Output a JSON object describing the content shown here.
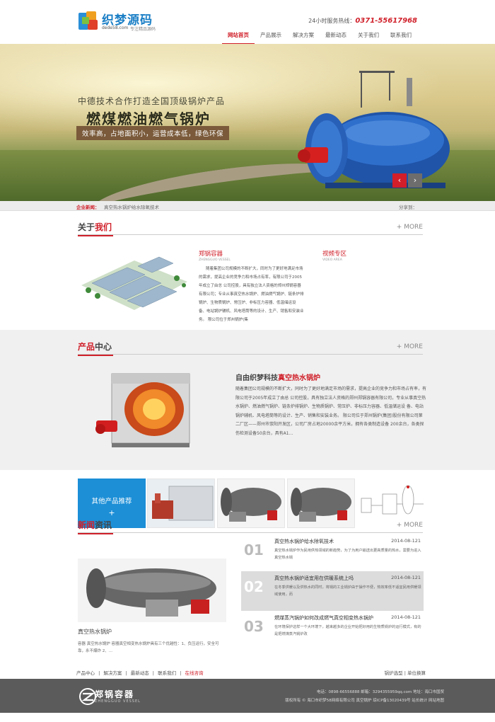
{
  "header": {
    "logo_text": "织梦源码",
    "logo_domain": "dede58.com",
    "logo_slogan": "专注精品源码",
    "hotline_label": "24小时服务热线：",
    "hotline_number": "0371-55617968",
    "nav": [
      {
        "label": "网站首页",
        "active": true
      },
      {
        "label": "产品展示",
        "active": false
      },
      {
        "label": "解决方案",
        "active": false
      },
      {
        "label": "最新动态",
        "active": false
      },
      {
        "label": "关于我们",
        "active": false
      },
      {
        "label": "联系我们",
        "active": false
      }
    ]
  },
  "banner": {
    "line1": "中德技术合作打造全国顶级锅炉产品",
    "line2": "燃煤燃油燃气锅炉",
    "tag": "效率高，占地面积小，运营成本低，绿色环保",
    "prev": "‹",
    "next": "›"
  },
  "ticker": {
    "label": "企业新闻：",
    "text": "真空热水锅炉给水除氧技术",
    "share": "分享到："
  },
  "about": {
    "title_hl": "关于",
    "title_rest": "我们",
    "more": "+ MORE",
    "company_name": "郑锅容器",
    "company_en": "ZHENGGUO VESSEL",
    "video_title": "视频专区",
    "video_en": "VIDEO AREA",
    "text": "随着集团公司规模的不断扩大，同时为了更好地满足市场的需求，提高企业的竞争力和市场占有率，有限公司于2005年成立了由总 公司控股，具有独立法人资格的郑州郑锅容器有限公司；专业从事真空热水锅炉、燃油燃气锅炉、链条炉排锅炉、生物质锅炉、常压炉、非标压力容器、低温储运设 备、电站锅炉辅机、风电塔筒等的设计、生产、销售和安装业务。 限公司位于郑州锅炉(集"
  },
  "products": {
    "title_hl": "产品",
    "title_rest": "中心",
    "more": "+ MORE",
    "prod_title_pre": "自由织梦科技",
    "prod_title_hl": "真空热水锅炉",
    "text": "随着集团公司规模的不断扩大，同时为了更好地满足市场的需求，提高企业的竞争力和市场占有率，有限公司于2005年成立了由总 公司控股，具有独立法人资格的郑州郑锅容器有限公司，专业从事真空热水锅炉、燃油燃气锅炉、链条炉排锅炉、生物质锅炉、常压炉、非标压力容器、低温储运设 备、电站锅炉辅机、风电塔筒等的设计、生产、销售和安装业务。 限公司位于郑州锅炉(集团)股份有限公司第二厂区——郑州市荥阳开发区，公司厂房占地20000余平方米，拥有各类制造设备 200余台，各类探伤检测设备50余台，具有A1..."
  },
  "recommend": {
    "title": "其他产品推荐",
    "plus": "+"
  },
  "news": {
    "title_hl": "新闻",
    "title_rest": "资讯",
    "more": "+ MORE",
    "main_title": "真空热水锅炉",
    "main_text": "容器 真空热水锅炉 容器真空相变热水锅炉具有三个优越性：1、负压运行，安全可靠，永不爆炸 2、...",
    "items": [
      {
        "num": "01",
        "title": "真空热水锅炉给水除氧技术",
        "date": "2014-08-121",
        "desc": "真空热水锅炉作为民用供热领域的新趋势，为了为用户输送出更高质量的热水，需要为进入真空热水锅"
      },
      {
        "num": "02",
        "title": "真空热水锅炉适宜用在供暖系统上吗",
        "date": "2014-08-121",
        "desc": "在冬季供暖以及供热水的同时，将锅的工业锅炉由于操作不便，热效率低不适宜民用供暖领域使用，而"
      },
      {
        "num": "03",
        "title": "燃煤蒸汽锅炉如何改成燃气真空相变热水锅炉",
        "date": "2014-08-121",
        "desc": "在环境保护这样一个大环境下，越来越多的企业开始把好用的生物质锅炉的运行模式，有的是把燃煤蒸汽锅炉改"
      }
    ]
  },
  "bottom_links": {
    "left": [
      "产品中心",
      "|",
      "解决方案",
      "|",
      "最新动态",
      "|",
      "联系我们",
      "|",
      "在线咨询"
    ],
    "right": "锅炉选型 | 单位换算"
  },
  "footer": {
    "logo_text": "郑锅容器",
    "logo_en": "ZHENGGUO VESSEL",
    "line1": "电话：0898-66556888 邮箱：3294355959qq.com 地址：海口市国贸",
    "line2": "版权所有 © 海口市织梦58网络有限公司 真空锅炉 琼ICP备13020439号 站长统计 网站地图"
  },
  "colors": {
    "accent_red": "#d0202a",
    "accent_blue": "#1c8fd7",
    "footer_bg": "#5b5b5b"
  }
}
